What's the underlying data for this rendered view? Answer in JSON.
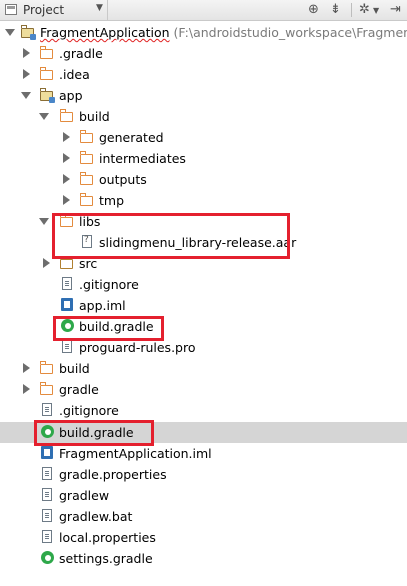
{
  "toolbar": {
    "label": "Project",
    "icons": [
      "target-icon",
      "collapse-icon",
      "gear-icon",
      "hide-icon"
    ]
  },
  "tree": [
    {
      "label": "FragmentApplication",
      "path": "(F:\\androidstudio_workspace\\Fragment/",
      "icon": "module-folder-icon",
      "state": "expanded"
    },
    {
      "label": ".gradle",
      "icon": "folder-icon",
      "state": "collapsed"
    },
    {
      "label": ".idea",
      "icon": "folder-icon",
      "state": "collapsed"
    },
    {
      "label": "app",
      "icon": "module-folder-icon",
      "state": "expanded"
    },
    {
      "label": "build",
      "icon": "folder-icon",
      "state": "expanded"
    },
    {
      "label": "generated",
      "icon": "folder-icon",
      "state": "collapsed"
    },
    {
      "label": "intermediates",
      "icon": "folder-icon",
      "state": "collapsed"
    },
    {
      "label": "outputs",
      "icon": "folder-icon",
      "state": "collapsed"
    },
    {
      "label": "tmp",
      "icon": "folder-icon",
      "state": "collapsed"
    },
    {
      "label": "libs",
      "icon": "folder-icon",
      "state": "expanded"
    },
    {
      "label": "slidingmenu_library-release.aar",
      "icon": "unknown-file-icon",
      "state": "leaf"
    },
    {
      "label": "src",
      "icon": "folder-icon",
      "state": "collapsed"
    },
    {
      "label": ".gitignore",
      "icon": "text-file-icon",
      "state": "leaf"
    },
    {
      "label": "app.iml",
      "icon": "iml-icon",
      "state": "leaf"
    },
    {
      "label": "build.gradle",
      "icon": "gradle-icon",
      "state": "leaf"
    },
    {
      "label": "proguard-rules.pro",
      "icon": "text-file-icon",
      "state": "leaf"
    },
    {
      "label": "build",
      "icon": "folder-icon",
      "state": "collapsed"
    },
    {
      "label": "gradle",
      "icon": "folder-icon",
      "state": "collapsed"
    },
    {
      "label": ".gitignore",
      "icon": "text-file-icon",
      "state": "leaf"
    },
    {
      "label": "build.gradle",
      "icon": "gradle-icon",
      "state": "leaf",
      "selected": true
    },
    {
      "label": "FragmentApplication.iml",
      "icon": "iml-icon",
      "state": "leaf"
    },
    {
      "label": "gradle.properties",
      "icon": "text-file-icon",
      "state": "leaf"
    },
    {
      "label": "gradlew",
      "icon": "text-file-icon",
      "state": "leaf"
    },
    {
      "label": "gradlew.bat",
      "icon": "text-file-icon",
      "state": "leaf"
    },
    {
      "label": "local.properties",
      "icon": "text-file-icon",
      "state": "leaf"
    },
    {
      "label": "settings.gradle",
      "icon": "gradle-icon",
      "state": "leaf"
    }
  ],
  "highlight_color": "#e4202e"
}
